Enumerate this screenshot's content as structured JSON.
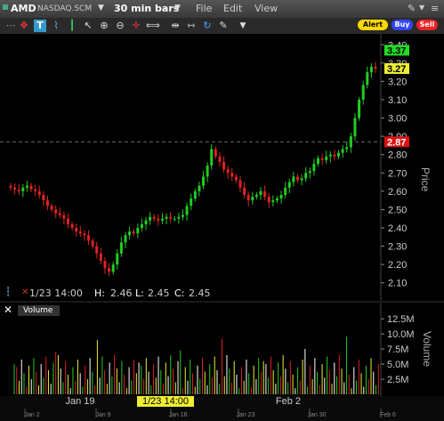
{
  "title": {
    "symbol": "AMD",
    "exchange": "NASDAQ.SCM",
    "bar_size": "30 min bars",
    "menu": [
      "File",
      "Edit",
      "View"
    ]
  },
  "toolbar": {
    "icons": [
      "grid-icon",
      "draw-icon",
      "text-tool-icon",
      "line-chart-icon",
      "bar-chart-icon",
      "cursor-icon",
      "zoom-in-icon",
      "zoom-out-icon",
      "crosshair-icon",
      "scroll-icon",
      "fit-icon",
      "refresh-icon",
      "wrench-icon",
      "dropdown-icon"
    ],
    "alert_label": "Alert",
    "buy_label": "Buy",
    "sell_label": "Sell",
    "alert_color": "#ffd700",
    "buy_color": "#3344ff",
    "sell_color": "#ee2222"
  },
  "price_pane": {
    "axis_title": "Price",
    "ticks": [
      "3.40",
      "3.30",
      "3.20",
      "3.10",
      "3.00",
      "2.90",
      "2.80",
      "2.70",
      "2.60",
      "2.50",
      "2.40",
      "2.30",
      "2.20",
      "2.10"
    ],
    "badge_green": "3.37",
    "badge_yellow": "3.27",
    "badge_red": "2.87",
    "info_time": "1/23 14:00",
    "info_h_label": "H:",
    "info_h": "2.46",
    "info_l_label": "L:",
    "info_l": "2.45",
    "info_c_label": "C:",
    "info_c": "2.45"
  },
  "volume_pane": {
    "label": "Volume",
    "axis_title": "Volume",
    "ticks": [
      "12.5M",
      "10.0M",
      "7.5M",
      "5.0M",
      "2.5M"
    ]
  },
  "x_axis": {
    "labels": [
      "Jan 19",
      "Feb 2"
    ],
    "small_labels": [
      "Jan 2",
      "Jan 9",
      "Jan 16",
      "Jan 23",
      "Jan 30",
      "Feb 6"
    ],
    "cursor_label": "1/23 14:00"
  },
  "chart_data": {
    "type": "candlestick",
    "ylim": [
      2.05,
      3.45
    ],
    "reference_line": 2.87,
    "volume_ylim": [
      0,
      14
    ],
    "volume_unit": "M",
    "close": [
      2.62,
      2.61,
      2.6,
      2.62,
      2.63,
      2.61,
      2.6,
      2.58,
      2.55,
      2.52,
      2.5,
      2.48,
      2.47,
      2.45,
      2.42,
      2.4,
      2.38,
      2.37,
      2.36,
      2.33,
      2.3,
      2.26,
      2.22,
      2.18,
      2.16,
      2.2,
      2.26,
      2.32,
      2.36,
      2.38,
      2.37,
      2.4,
      2.42,
      2.44,
      2.46,
      2.45,
      2.44,
      2.45,
      2.46,
      2.45,
      2.45,
      2.46,
      2.47,
      2.52,
      2.56,
      2.6,
      2.63,
      2.68,
      2.74,
      2.83,
      2.79,
      2.76,
      2.72,
      2.7,
      2.68,
      2.66,
      2.62,
      2.58,
      2.55,
      2.57,
      2.58,
      2.6,
      2.57,
      2.54,
      2.55,
      2.56,
      2.58,
      2.62,
      2.65,
      2.68,
      2.66,
      2.67,
      2.7,
      2.71,
      2.75,
      2.78,
      2.77,
      2.79,
      2.8,
      2.79,
      2.81,
      2.83,
      2.84,
      2.9,
      3.0,
      3.1,
      3.18,
      3.25,
      3.28,
      3.27
    ]
  }
}
